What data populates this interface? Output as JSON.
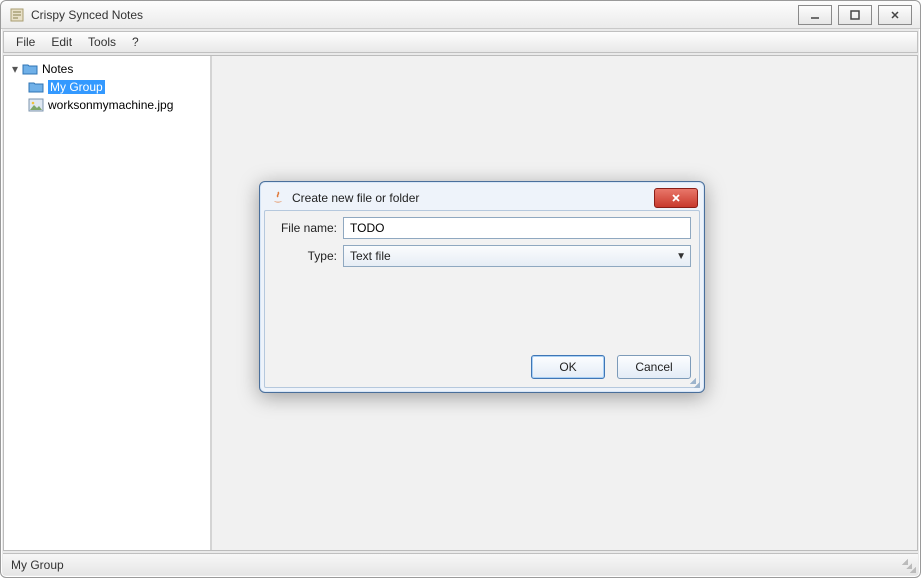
{
  "window": {
    "title": "Crispy Synced Notes"
  },
  "menu": {
    "items": [
      "File",
      "Edit",
      "Tools",
      "?"
    ]
  },
  "tree": {
    "root": {
      "label": "Notes"
    },
    "children": [
      {
        "label": "My Group",
        "type": "folder",
        "selected": true
      },
      {
        "label": "worksonmymachine.jpg",
        "type": "image"
      }
    ]
  },
  "dialog": {
    "title": "Create new file or folder",
    "filename_label": "File name:",
    "filename_value": "TODO",
    "type_label": "Type:",
    "type_value": "Text file",
    "ok": "OK",
    "cancel": "Cancel"
  },
  "status": {
    "text": "My Group"
  }
}
